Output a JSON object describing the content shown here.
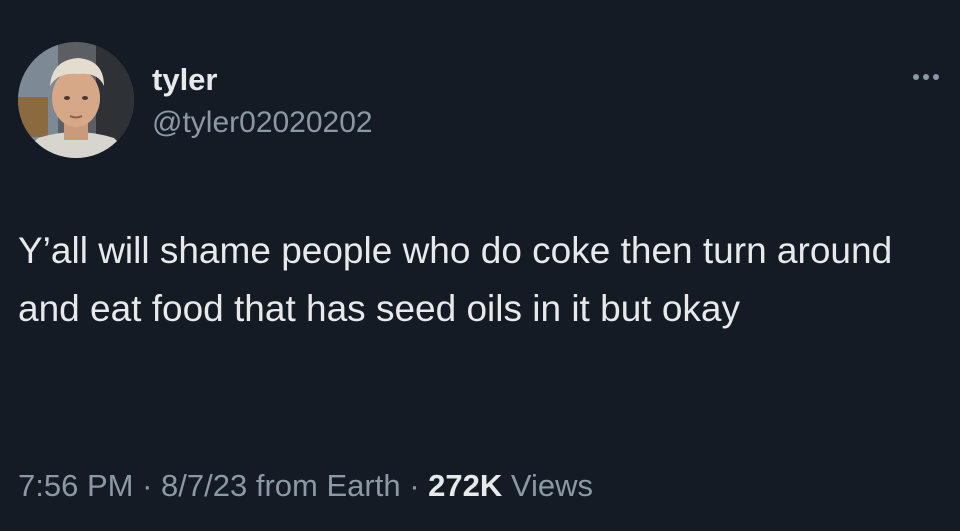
{
  "author": {
    "display_name": "tyler",
    "handle": "@tyler02020202"
  },
  "tweet": {
    "text": "Y’all will shame people who do coke then turn around and eat food that has seed oils in it but okay"
  },
  "meta": {
    "time": "7:56 PM",
    "separator": "·",
    "date": "8/7/23",
    "source": "from Earth",
    "views_count": "272K",
    "views_label": "Views"
  },
  "icons": {
    "more": "more-horizontal-icon",
    "avatar": "profile-photo"
  },
  "colors": {
    "background": "#151b24",
    "primary_text": "#e7e9ea",
    "secondary_text": "#8b98a5"
  }
}
